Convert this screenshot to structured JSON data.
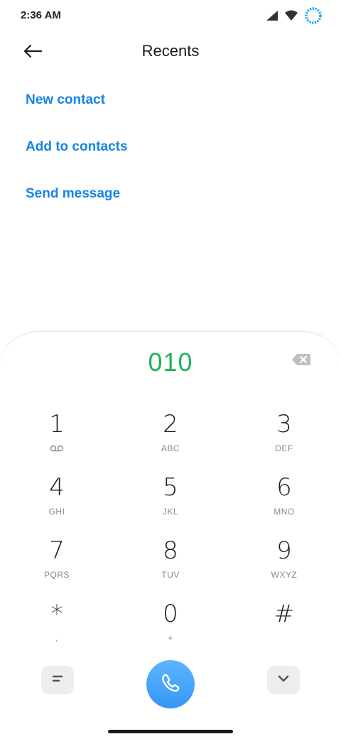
{
  "status_bar": {
    "time": "2:36 AM",
    "icons": [
      "signal-icon",
      "wifi-icon",
      "loading-ring-icon"
    ]
  },
  "header": {
    "title": "Recents",
    "back_icon": "arrow-left-icon"
  },
  "actions": [
    {
      "label": "New contact"
    },
    {
      "label": "Add to contacts"
    },
    {
      "label": "Send message"
    }
  ],
  "dialer": {
    "number": "010",
    "backspace_icon": "backspace-icon",
    "keys": [
      {
        "digit": "1",
        "letters": "",
        "sub_icon": "voicemail-icon"
      },
      {
        "digit": "2",
        "letters": "ABC"
      },
      {
        "digit": "3",
        "letters": "DEF"
      },
      {
        "digit": "4",
        "letters": "GHI"
      },
      {
        "digit": "5",
        "letters": "JKL"
      },
      {
        "digit": "6",
        "letters": "MNO"
      },
      {
        "digit": "7",
        "letters": "PQRS"
      },
      {
        "digit": "8",
        "letters": "TUV"
      },
      {
        "digit": "9",
        "letters": "WXYZ"
      },
      {
        "digit": "*",
        "letters": ","
      },
      {
        "digit": "0",
        "letters": "+"
      },
      {
        "digit": "#",
        "letters": ""
      }
    ],
    "bottom": {
      "menu_icon": "menu-icon",
      "call_icon": "phone-icon",
      "collapse_icon": "chevron-down-icon"
    }
  },
  "colors": {
    "accent_blue": "#1684e6",
    "number_green": "#1fb35a",
    "call_button": "#3796f5"
  }
}
